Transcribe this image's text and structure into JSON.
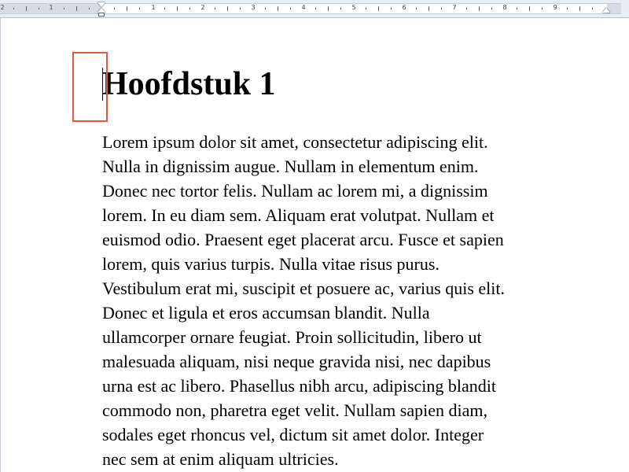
{
  "ruler": {
    "numbers": [
      "2",
      "1",
      "1",
      "2",
      "3",
      "4",
      "5",
      "6",
      "7",
      "8",
      "9"
    ]
  },
  "document": {
    "heading": "Hoofdstuk 1",
    "body_lines": [
      "Lorem ipsum dolor sit amet, consectetur adipiscing elit.",
      "Nulla in dignissim augue. Nullam in elementum enim.",
      "Donec nec tortor felis. Nullam ac lorem mi, a dignissim",
      "lorem. In eu diam sem. Aliquam erat volutpat. Nullam et",
      "euismod odio. Praesent eget placerat arcu. Fusce et sapien",
      "lorem, quis varius turpis. Nulla vitae risus purus.",
      "Vestibulum erat mi, suscipit et posuere ac, varius quis elit.",
      "Donec et ligula et eros accumsan blandit. Nulla",
      "ullamcorper ornare feugiat. Proin sollicitudin, libero ut",
      "malesuada aliquam, nisi neque gravida nisi, nec dapibus",
      "urna est ac libero. Phasellus nibh arcu, adipiscing blandit",
      "commodo non, pharetra eget velit. Nullam sapien diam,",
      "sodales eget rhoncus vel, dictum sit amet dolor. Integer",
      "nec sem at enim aliquam ultricies."
    ]
  },
  "colors": {
    "highlight_border": "#e05a3f",
    "ruler_background": "#e9eef5",
    "text": "#000000"
  }
}
